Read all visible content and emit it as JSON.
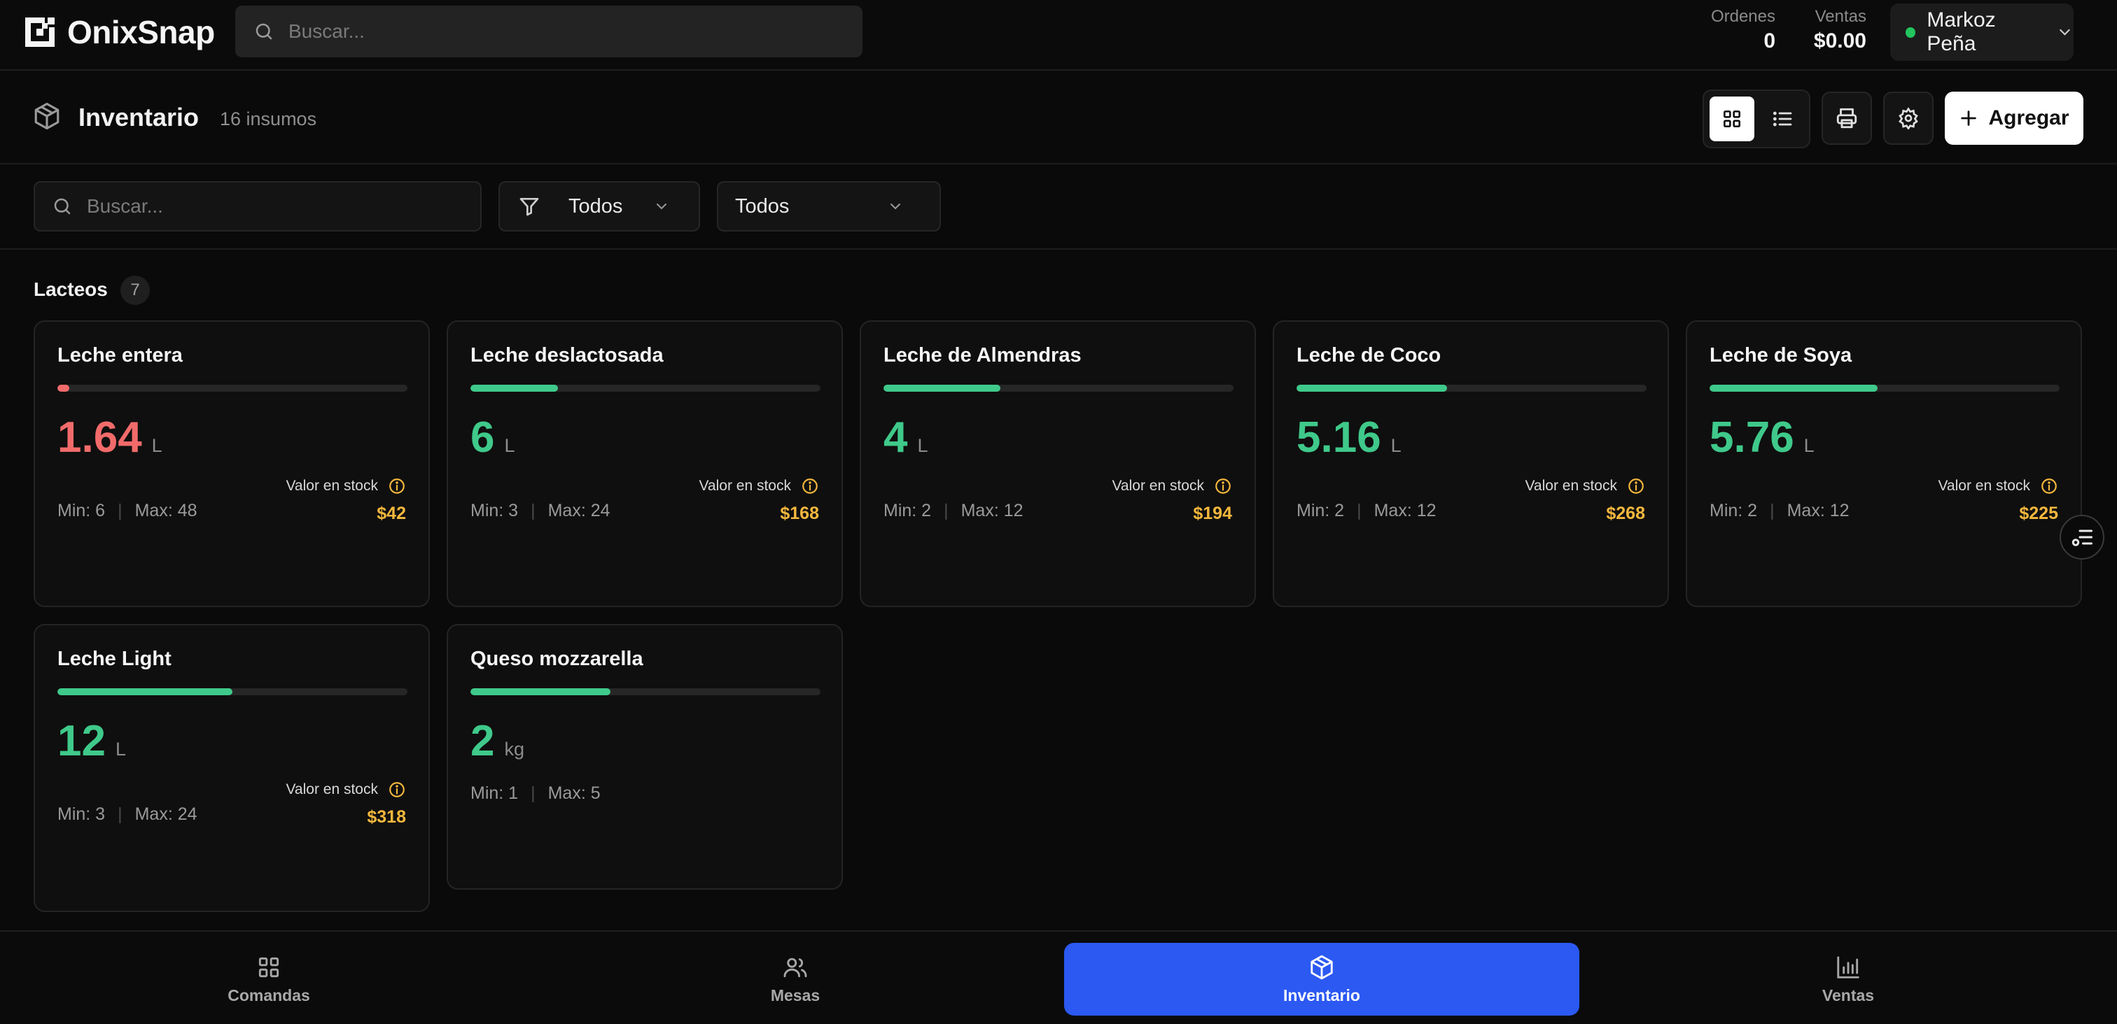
{
  "app": {
    "name": "OnixSnap"
  },
  "topbar": {
    "search_placeholder": "Buscar...",
    "ordenes_label": "Ordenes",
    "ordenes_value": "0",
    "ventas_label": "Ventas",
    "ventas_value": "$0.00",
    "user_name": "Markoz Peña",
    "user_status_color": "#22c55e"
  },
  "page": {
    "title": "Inventario",
    "count": "16 insumos",
    "add_label": "Agregar"
  },
  "filters": {
    "search_placeholder": "Buscar...",
    "type_filter": "Todos",
    "category_filter": "Todos"
  },
  "section": {
    "title": "Lacteos",
    "count": "7"
  },
  "colors": {
    "low": "#f26b6b",
    "ok": "#3fc98a",
    "stock_value": "#f5b83d",
    "accent": "#2b59f2"
  },
  "items": [
    {
      "name": "Leche entera",
      "qty": "1.64",
      "unit": "L",
      "level": 0.034,
      "status": "low",
      "min": "Min: 6",
      "max": "Max: 48",
      "stock_label": "Valor en stock",
      "stock_value": "$42"
    },
    {
      "name": "Leche deslactosada",
      "qty": "6",
      "unit": "L",
      "level": 0.25,
      "status": "ok",
      "min": "Min: 3",
      "max": "Max: 24",
      "stock_label": "Valor en stock",
      "stock_value": "$168"
    },
    {
      "name": "Leche de Almendras",
      "qty": "4",
      "unit": "L",
      "level": 0.333,
      "status": "ok",
      "min": "Min: 2",
      "max": "Max: 12",
      "stock_label": "Valor en stock",
      "stock_value": "$194"
    },
    {
      "name": "Leche de Coco",
      "qty": "5.16",
      "unit": "L",
      "level": 0.43,
      "status": "ok",
      "min": "Min: 2",
      "max": "Max: 12",
      "stock_label": "Valor en stock",
      "stock_value": "$268"
    },
    {
      "name": "Leche de Soya",
      "qty": "5.76",
      "unit": "L",
      "level": 0.48,
      "status": "ok",
      "min": "Min: 2",
      "max": "Max: 12",
      "stock_label": "Valor en stock",
      "stock_value": "$225"
    },
    {
      "name": "Leche Light",
      "qty": "12",
      "unit": "L",
      "level": 0.5,
      "status": "ok",
      "min": "Min: 3",
      "max": "Max: 24",
      "stock_label": "Valor en stock",
      "stock_value": "$318"
    },
    {
      "name": "Queso mozzarella",
      "qty": "2",
      "unit": "kg",
      "level": 0.4,
      "status": "ok",
      "min": "Min: 1",
      "max": "Max: 5"
    }
  ],
  "nav": [
    {
      "label": "Comandas",
      "icon": "grid-icon"
    },
    {
      "label": "Mesas",
      "icon": "users-icon"
    },
    {
      "label": "Inventario",
      "icon": "box-icon",
      "active": true
    },
    {
      "label": "Ventas",
      "icon": "bar-chart-icon"
    }
  ]
}
